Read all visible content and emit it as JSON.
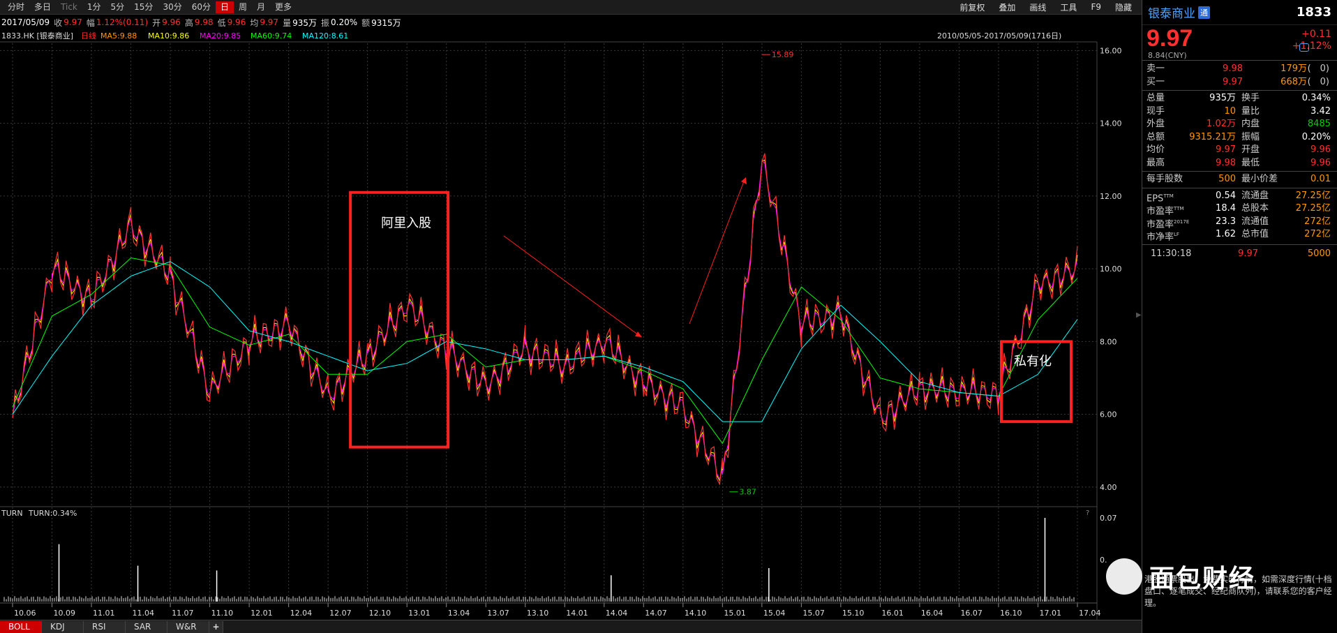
{
  "toolbar": {
    "periods": [
      "分时",
      "多日",
      "Tick",
      "1分",
      "5分",
      "15分",
      "30分",
      "60分",
      "日",
      "周",
      "月",
      "更多"
    ],
    "tools": [
      "前复权",
      "叠加",
      "画线",
      "工具",
      "F9",
      "隐藏"
    ]
  },
  "info": {
    "date": "2017/05/09",
    "close_label": "收",
    "close": "9.97",
    "change_label": "幅",
    "change": "1.12%(0.11)",
    "open_label": "开",
    "open": "9.96",
    "high_label": "高",
    "high": "9.98",
    "low_label": "低",
    "low": "9.96",
    "avg_label": "均",
    "avg": "9.97",
    "vol_label": "量",
    "vol": "935万",
    "amp_label": "振",
    "amp": "0.20%",
    "amt_label": "额",
    "amt": "9315万"
  },
  "legend": {
    "code": "1833.HK [银泰商业]",
    "period": "日线",
    "ma5": "MA5:9.88",
    "ma10": "MA10:9.86",
    "ma20": "MA20:9.85",
    "ma60": "MA60:9.74",
    "ma120": "MA120:8.61",
    "range": "2010/05/05-2017/05/09(1716日)"
  },
  "indicator": {
    "name": "TURN",
    "value": "TURN:0.34%"
  },
  "annotations": {
    "ali": "阿里入股",
    "private": "私有化",
    "high_marker": "15.89",
    "low_marker": "3.87"
  },
  "bottom_tabs": [
    "BOLL",
    "KDJ",
    "RSI",
    "SAR",
    "W&R",
    "+"
  ],
  "colors": {
    "up": "#ff3030",
    "down": "#00d0d0",
    "ma5": "#ffffff",
    "ma10": "#ffff00",
    "ma20": "#ff00ff",
    "ma60": "#00ff00",
    "ma120": "#00ffff",
    "box": "#ff2020"
  },
  "chart_data": [
    {
      "type": "line",
      "title": "1833.HK 银泰商业 日线",
      "x": [
        "10.06",
        "10.09",
        "11.01",
        "11.04",
        "11.07",
        "11.10",
        "12.01",
        "12.04",
        "12.07",
        "12.10",
        "13.01",
        "13.04",
        "13.07",
        "13.10",
        "14.01",
        "14.04",
        "14.07",
        "14.10",
        "15.01",
        "15.04",
        "15.07",
        "15.10",
        "16.01",
        "16.04",
        "16.07",
        "16.10",
        "17.01",
        "17.04"
      ],
      "ylim": [
        3.5,
        16.2
      ],
      "yticks": [
        "16.00",
        "14.00",
        "12.00",
        "10.00",
        "8.00",
        "6.00",
        "4.00"
      ],
      "series": [
        {
          "name": "价格",
          "values": [
            5.9,
            10.0,
            9.2,
            11.2,
            9.8,
            6.6,
            8.0,
            8.5,
            6.5,
            7.6,
            9.0,
            7.8,
            6.8,
            7.8,
            7.3,
            8.0,
            6.9,
            6.2,
            4.2,
            13.0,
            8.5,
            8.8,
            5.9,
            6.7,
            6.6,
            6.6,
            9.6,
            9.97
          ]
        },
        {
          "name": "MA60",
          "values": [
            6.2,
            8.7,
            9.3,
            10.3,
            10.1,
            8.4,
            7.9,
            8.2,
            7.1,
            7.1,
            8.0,
            8.2,
            7.3,
            7.5,
            7.5,
            7.6,
            7.2,
            6.7,
            5.2,
            7.5,
            9.5,
            8.6,
            7.0,
            6.7,
            6.6,
            6.5,
            8.6,
            9.74
          ]
        },
        {
          "name": "MA120",
          "values": [
            6.0,
            7.6,
            9.0,
            9.8,
            10.2,
            9.5,
            8.3,
            8.0,
            7.6,
            7.2,
            7.4,
            8.0,
            7.8,
            7.5,
            7.5,
            7.6,
            7.3,
            6.9,
            5.8,
            5.8,
            7.8,
            9.0,
            8.0,
            6.9,
            6.6,
            6.5,
            7.1,
            8.61
          ]
        }
      ],
      "markers": [
        {
          "label": "15.89",
          "x": "15.04",
          "y": 15.89
        },
        {
          "label": "3.87",
          "x": "15.01",
          "y": 3.87
        }
      ]
    },
    {
      "type": "bar",
      "title": "TURN",
      "ylim": [
        0,
        0.07
      ],
      "yticks": [
        "0.07",
        "0."
      ],
      "spikes": [
        {
          "x": "10.09",
          "value": 0.048
        },
        {
          "x": "11.04",
          "value": 0.03
        },
        {
          "x": "11.10",
          "value": 0.026
        },
        {
          "x": "14.04",
          "value": 0.022
        },
        {
          "x": "15.04",
          "value": 0.028
        },
        {
          "x": "17.01",
          "value": 0.07
        }
      ]
    }
  ],
  "quote": {
    "name": "银泰商业",
    "badge": "通",
    "code": "1833",
    "price": "9.97",
    "change": "+0.11",
    "change_pct": "+1.12%",
    "cny": "8.84(CNY)",
    "ask": {
      "label": "卖一",
      "price": "9.98",
      "vol": "179万",
      "orders": "(　0)"
    },
    "bid": {
      "label": "买一",
      "price": "9.97",
      "vol": "668万",
      "orders": "(　0)"
    },
    "stats": [
      [
        "总量",
        "935万",
        "换手",
        "0.34%"
      ],
      [
        "现手",
        "10",
        "量比",
        "3.42"
      ],
      [
        "外盘",
        "1.02万",
        "内盘",
        "8485"
      ],
      [
        "总额",
        "9315.21万",
        "振幅",
        "0.20%"
      ],
      [
        "均价",
        "9.97",
        "开盘",
        "9.96"
      ],
      [
        "最高",
        "9.98",
        "最低",
        "9.96"
      ]
    ],
    "lot": [
      "每手股数",
      "500",
      "最小价差",
      "0.01"
    ],
    "fund": [
      [
        "EPS TTM",
        "0.54",
        "流通盘",
        "27.25亿"
      ],
      [
        "市盈率 TTM",
        "18.4",
        "总股本",
        "27.25亿"
      ],
      [
        "市盈率 2017E",
        "23.3",
        "流通值",
        "272亿"
      ],
      [
        "市净率 LF",
        "1.62",
        "总市值",
        "272亿"
      ]
    ],
    "tick": {
      "time": "11:30:18",
      "price": "9.97",
      "vol": "5000"
    },
    "note": "港股通票股出，免费实时行情，如需深度行情(十档盘口、逐笔成交、经纪商队列)，请联系您的客户经理。"
  },
  "watermark": "面包财经"
}
